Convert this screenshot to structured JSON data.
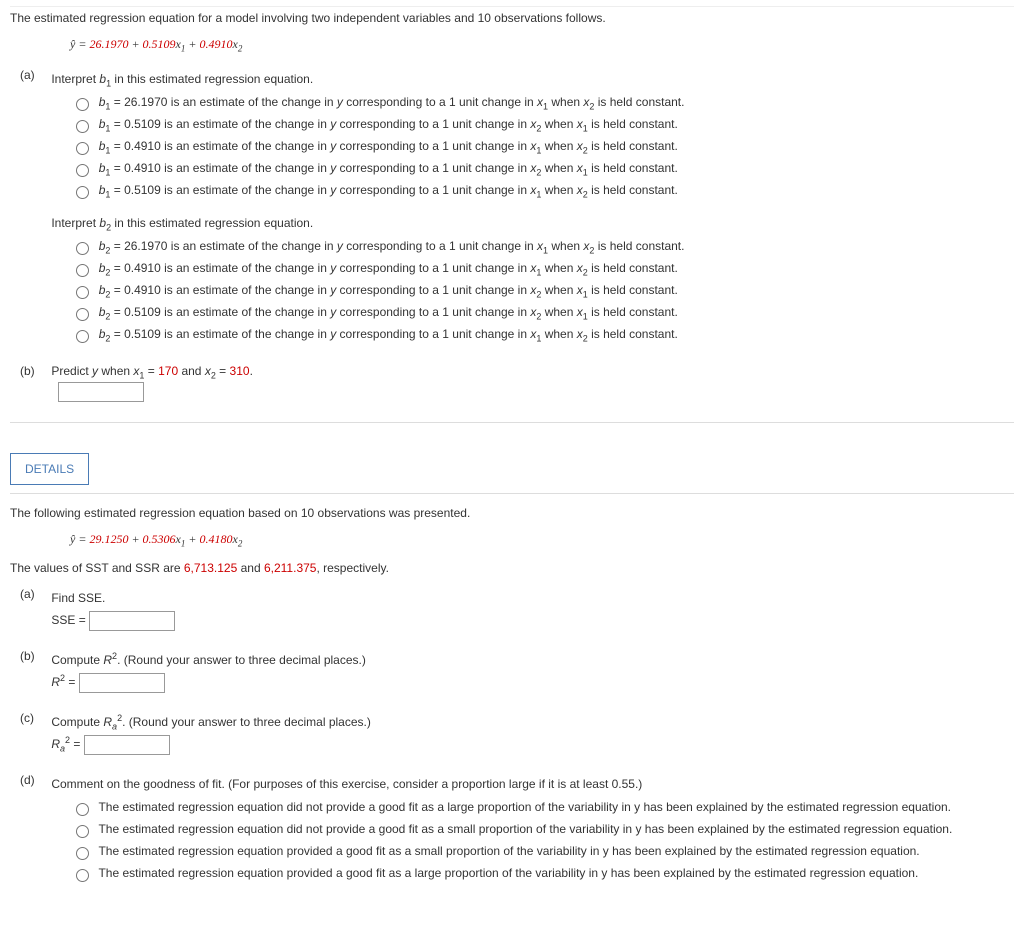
{
  "q1": {
    "intro": "The estimated regression equation for a model involving two independent variables and 10 observations follows.",
    "eq_prefix": "ŷ = ",
    "c0": "26.1970",
    "plus1": " + ",
    "c1": "0.5109",
    "x1": "x",
    "plus2": " + ",
    "c2": "0.4910",
    "x2": "x",
    "a": {
      "label": "(a)",
      "prompt1": "Interpret b₁ in this estimated regression equation.",
      "choices1": [
        "b₁ = 26.1970 is an estimate of the change in y corresponding to a 1 unit change in x₁ when x₂ is held constant.",
        "b₁ = 0.5109 is an estimate of the change in y corresponding to a 1 unit change in x₂ when x₁ is held constant.",
        "b₁ = 0.4910 is an estimate of the change in y corresponding to a 1 unit change in x₁ when x₂ is held constant.",
        "b₁ = 0.4910 is an estimate of the change in y corresponding to a 1 unit change in x₂ when x₁ is held constant.",
        "b₁ = 0.5109 is an estimate of the change in y corresponding to a 1 unit change in x₁ when x₂ is held constant."
      ],
      "prompt2": "Interpret b₂ in this estimated regression equation.",
      "choices2": [
        "b₂ = 26.1970 is an estimate of the change in y corresponding to a 1 unit change in x₁ when x₂ is held constant.",
        "b₂ = 0.4910 is an estimate of the change in y corresponding to a 1 unit change in x₁ when x₂ is held constant.",
        "b₂ = 0.4910 is an estimate of the change in y corresponding to a 1 unit change in x₂ when x₁ is held constant.",
        "b₂ = 0.5109 is an estimate of the change in y corresponding to a 1 unit change in x₂ when x₁ is held constant.",
        "b₂ = 0.5109 is an estimate of the change in y corresponding to a 1 unit change in x₁ when x₂ is held constant."
      ]
    },
    "b": {
      "label": "(b)",
      "prompt_pre": "Predict y when x₁ = ",
      "v1": "170",
      "mid": " and x₂ = ",
      "v2": "310",
      "end": "."
    }
  },
  "details_label": "DETAILS",
  "q2": {
    "intro": "The following estimated regression equation based on 10 observations was presented.",
    "eq_prefix": "ŷ = ",
    "c0": "29.1250",
    "plus1": " + ",
    "c1": "0.5306",
    "plus2": " + ",
    "c2": "0.4180",
    "sst_line_pre": "The values of SST and SSR are ",
    "sst": "6,713.125",
    "sst_mid": " and ",
    "ssr": "6,211.375",
    "sst_end": ", respectively.",
    "a": {
      "label": "(a)",
      "prompt": "Find SSE.",
      "lhs": "SSE = "
    },
    "b": {
      "label": "(b)",
      "prompt": "Compute R². (Round your answer to three decimal places.)",
      "lhs": "R² = "
    },
    "c": {
      "label": "(c)",
      "prompt": "Compute Rₐ². (Round your answer to three decimal places.)",
      "lhs": "Rₐ² = "
    },
    "d": {
      "label": "(d)",
      "prompt": "Comment on the goodness of fit. (For purposes of this exercise, consider a proportion large if it is at least 0.55.)",
      "choices": [
        "The estimated regression equation did not provide a good fit as a large proportion of the variability in y has been explained by the estimated regression equation.",
        "The estimated regression equation did not provide a good fit as a small proportion of the variability in y has been explained by the estimated regression equation.",
        "The estimated regression equation provided a good fit as a small proportion of the variability in y has been explained by the estimated regression equation.",
        "The estimated regression equation provided a good fit as a large proportion of the variability in y has been explained by the estimated regression equation."
      ]
    }
  }
}
